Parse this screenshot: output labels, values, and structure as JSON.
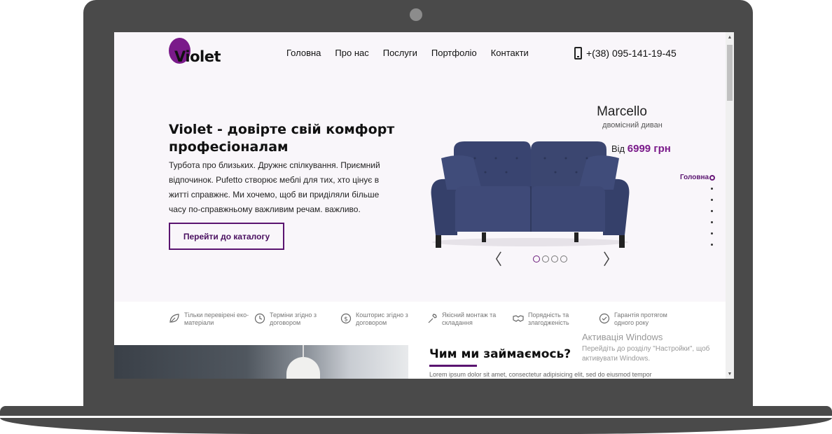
{
  "header": {
    "logo_text": "Violet",
    "nav": [
      "Головна",
      "Про нас",
      "Послуги",
      "Портфоліо",
      "Контакти"
    ],
    "phone": "+(38) 095-141-19-45"
  },
  "hero": {
    "title": "Violet - довірте свій комфорт професіоналам",
    "text": "Турбота про близьких. Дружнє спілкування. Приємний відпочинок. Pufetto створює меблі для тих, хто цінує в житті справжнє. Ми хочемо, щоб ви приділяли більше часу по-справжньому важливим речам. важливо.",
    "cta_label": "Перейти до каталогу"
  },
  "product": {
    "name": "Marcello",
    "subtitle": "двомісний диван",
    "price_prefix": "Від",
    "price_amount": "6999 грн"
  },
  "slider": {
    "prev_icon": "chevron-left-icon",
    "next_icon": "chevron-right-icon",
    "prev_glyph": "〈",
    "next_glyph": "〉",
    "slide_count": 4,
    "active_slide": 1
  },
  "side_nav": {
    "active_label": "Головна",
    "extra_dots": 6
  },
  "features": [
    {
      "icon": "leaf-icon",
      "text": "Тільки перевірені еко-матеріали"
    },
    {
      "icon": "clock-icon",
      "text": "Терміни згідно з договором"
    },
    {
      "icon": "dollar-icon",
      "text": "Кошторис згідно з договором"
    },
    {
      "icon": "wrench-icon",
      "text": "Якісний монтаж та складання"
    },
    {
      "icon": "handshake-icon",
      "text": "Порядність та злагодженість"
    },
    {
      "icon": "check-shield-icon",
      "text": "Гарантія протягом одного року"
    }
  ],
  "about": {
    "title": "Чим ми займаємось?",
    "lorem": "Lorem ipsum dolor sit amet, consectetur adipisicing elit, sed do eiusmod tempor"
  },
  "windows_activation": {
    "title": "Активація Windows",
    "text": "Перейдіть до розділу \"Настройки\", щоб активувати Windows."
  },
  "scrollbar": {
    "up_glyph": "▲",
    "down_glyph": "▼"
  },
  "colors": {
    "accent": "#7a1a8a",
    "frame": "#4a4a4a",
    "page_bg": "#f9f6fa",
    "sofa": "#3b4670"
  }
}
